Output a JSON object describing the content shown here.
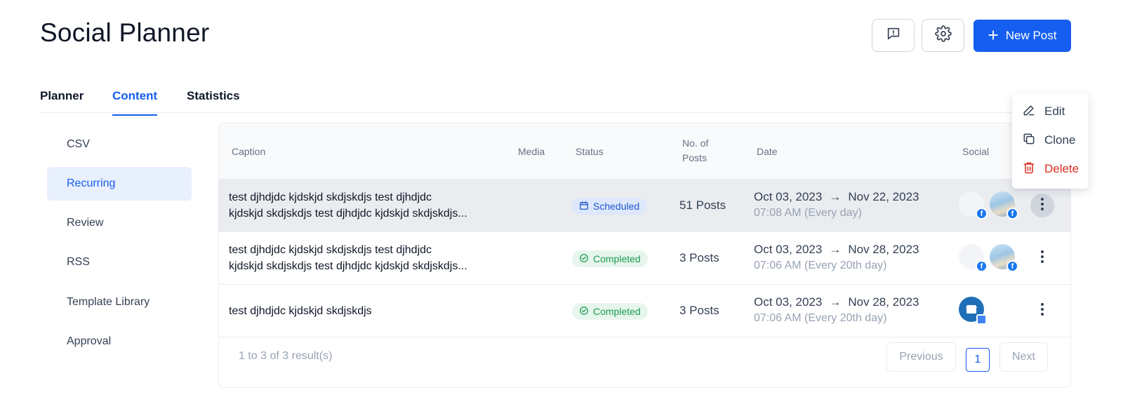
{
  "header": {
    "title": "Social Planner",
    "new_post_label": "New Post"
  },
  "tabs": [
    {
      "label": "Planner",
      "active": false
    },
    {
      "label": "Content",
      "active": true
    },
    {
      "label": "Statistics",
      "active": false
    }
  ],
  "sidebar": {
    "items": [
      {
        "label": "CSV",
        "active": false
      },
      {
        "label": "Recurring",
        "active": true
      },
      {
        "label": "Review",
        "active": false
      },
      {
        "label": "RSS",
        "active": false
      },
      {
        "label": "Template Library",
        "active": false
      },
      {
        "label": "Approval",
        "active": false
      }
    ]
  },
  "table": {
    "columns": {
      "caption": "Caption",
      "media": "Media",
      "status": "Status",
      "posts_line1": "No. of",
      "posts_line2": "Posts",
      "date": "Date",
      "social": "Social"
    },
    "rows": [
      {
        "caption_line1": "test djhdjdc kjdskjd skdjskdjs test djhdjdc",
        "caption_line2": "kjdskjd skdjskdjs test djhdjdc kjdskjd skdjskdjs...",
        "status": "Scheduled",
        "posts": "51 Posts",
        "date_start": "Oct 03, 2023",
        "date_end": "Nov 22, 2023",
        "time": "07:08 AM (Every day)"
      },
      {
        "caption_line1": "test djhdjdc kjdskjd skdjskdjs test djhdjdc",
        "caption_line2": "kjdskjd skdjskdjs test djhdjdc kjdskjd skdjskdjs...",
        "status": "Completed",
        "posts": "3 Posts",
        "date_start": "Oct 03, 2023",
        "date_end": "Nov 28, 2023",
        "time": "07:06 AM (Every 20th day)"
      },
      {
        "caption_line1": "test djhdjdc kjdskjd skdjskdjs",
        "caption_line2": "",
        "status": "Completed",
        "posts": "3 Posts",
        "date_start": "Oct 03, 2023",
        "date_end": "Nov 28, 2023",
        "time": "07:06 AM (Every 20th day)"
      }
    ]
  },
  "pagination": {
    "summary": "1 to 3 of 3 result(s)",
    "previous": "Previous",
    "current_page": "1",
    "next": "Next"
  },
  "context_menu": {
    "edit": "Edit",
    "clone": "Clone",
    "delete": "Delete"
  },
  "colors": {
    "accent": "#155eef",
    "scheduled": "#1e58c9",
    "completed": "#1a9b53",
    "danger": "#d92d20"
  }
}
